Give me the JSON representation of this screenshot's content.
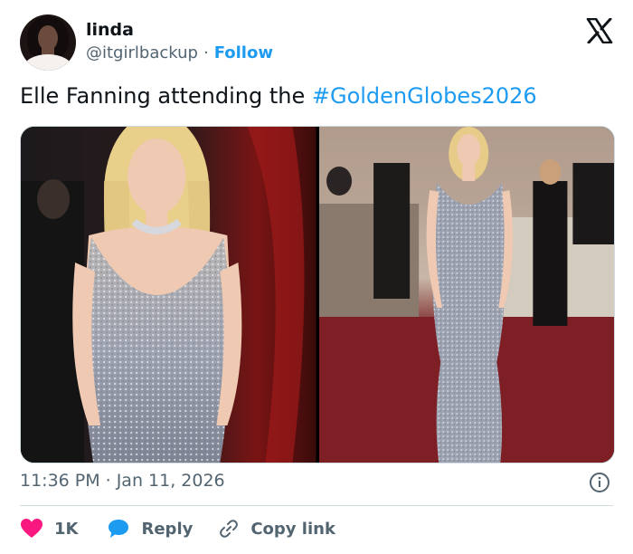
{
  "user": {
    "display_name": "linda",
    "handle": "@itgirlbackup",
    "separator": "·",
    "follow_label": "Follow"
  },
  "tweet": {
    "text_prefix": "Elle Fanning attending the ",
    "hashtag": "#GoldenGlobes2026"
  },
  "media": {
    "images": [
      {
        "alt": "Elle Fanning in sparkling silver gown, close-up"
      },
      {
        "alt": "Elle Fanning full-length on red carpet"
      }
    ]
  },
  "meta": {
    "time": "11:36 PM",
    "separator": "·",
    "date": "Jan 11, 2026"
  },
  "actions": {
    "like_count": "1K",
    "reply_label": "Reply",
    "copy_link_label": "Copy link"
  },
  "colors": {
    "accent": "#1d9bf0",
    "like": "#f91880",
    "text": "#0f1419",
    "muted": "#536471",
    "border": "#cfd9de"
  },
  "icons": {
    "logo": "x-logo-icon",
    "info": "info-icon",
    "like": "heart-icon",
    "reply": "speech-bubble-icon",
    "copy": "link-icon"
  }
}
